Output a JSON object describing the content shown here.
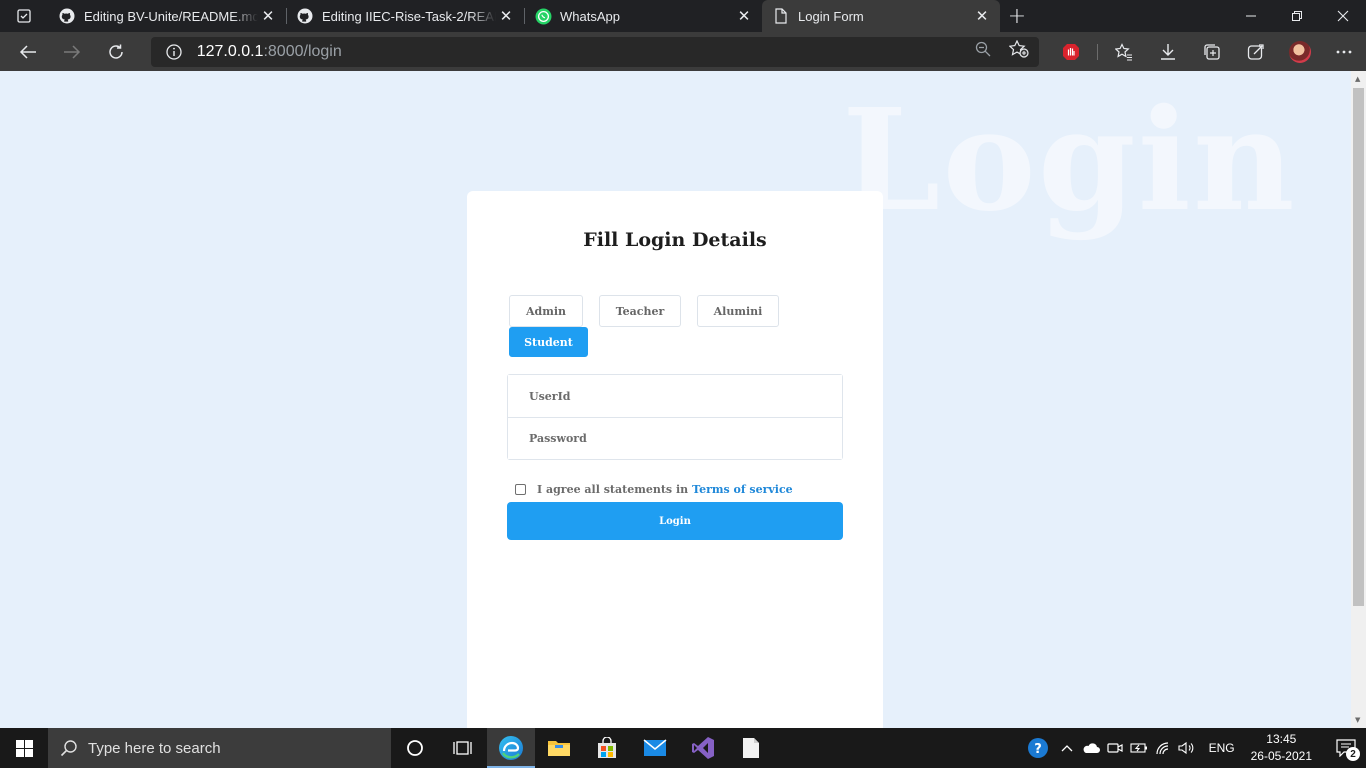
{
  "browser": {
    "tabs": [
      {
        "title": "Editing BV-Unite/README.md at",
        "icon": "github-icon",
        "active": false
      },
      {
        "title": "Editing IIEC-Rise-Task-2/README",
        "icon": "github-icon",
        "active": false
      },
      {
        "title": "WhatsApp",
        "icon": "whatsapp-icon",
        "active": false
      },
      {
        "title": "Login Form",
        "icon": "page-icon",
        "active": true
      }
    ],
    "address": {
      "host": "127.0.0.1",
      "path": ":8000/login"
    }
  },
  "page": {
    "background_word": "Login",
    "title": "Fill Login Details",
    "roles": [
      "Admin",
      "Teacher",
      "Alumini",
      "Student"
    ],
    "active_role": "Student",
    "userid_placeholder": "UserId",
    "password_placeholder": "Password",
    "agree_text": "I agree all statements in",
    "terms_link": "Terms of service",
    "login_button": "Login",
    "colors": {
      "accent": "#1f9ef2",
      "page_bg": "#e6f0fb",
      "link": "#1f88d9"
    }
  },
  "taskbar": {
    "search_placeholder": "Type here to search",
    "language": "ENG",
    "time": "13:45",
    "date": "26-05-2021",
    "notification_count": "2"
  }
}
